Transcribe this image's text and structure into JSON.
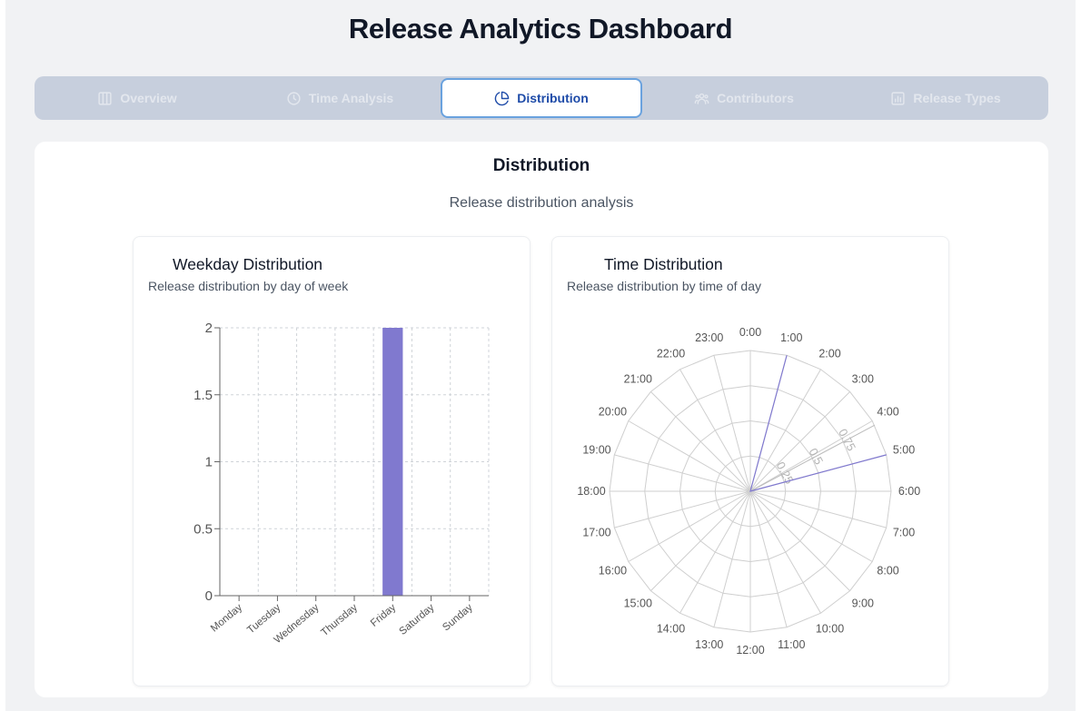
{
  "header": {
    "title": "Release Analytics Dashboard"
  },
  "tabs": [
    {
      "label": "Overview",
      "icon": "columns-icon",
      "active": false
    },
    {
      "label": "Time Analysis",
      "icon": "clock-icon",
      "active": false
    },
    {
      "label": "Distribution",
      "icon": "pie-chart-icon",
      "active": true
    },
    {
      "label": "Contributors",
      "icon": "users-icon",
      "active": false
    },
    {
      "label": "Release Types",
      "icon": "bar-chart-icon",
      "active": false
    }
  ],
  "panel": {
    "title": "Distribution",
    "subtitle": "Release distribution analysis"
  },
  "colors": {
    "bar_fill": "#8079cf",
    "radar_stroke": "#8079cf",
    "active_tab_text": "#1e4ba8",
    "active_tab_border": "#6aa2de"
  },
  "chart_data": [
    {
      "type": "bar",
      "title": "Weekday Distribution",
      "subtitle": "Release distribution by day of week",
      "categories": [
        "Monday",
        "Tuesday",
        "Wednesday",
        "Thursday",
        "Friday",
        "Saturday",
        "Sunday"
      ],
      "values": [
        0,
        0,
        0,
        0,
        2,
        0,
        0
      ],
      "ylim": [
        0,
        2
      ],
      "yticks": [
        "0",
        "0.5",
        "1",
        "1.5",
        "2"
      ],
      "grid": true
    },
    {
      "type": "radar",
      "title": "Time Distribution",
      "subtitle": "Release distribution by time of day",
      "categories": [
        "0:00",
        "1:00",
        "2:00",
        "3:00",
        "4:00",
        "5:00",
        "6:00",
        "7:00",
        "8:00",
        "9:00",
        "10:00",
        "11:00",
        "12:00",
        "13:00",
        "14:00",
        "15:00",
        "16:00",
        "17:00",
        "18:00",
        "19:00",
        "20:00",
        "21:00",
        "22:00",
        "23:00"
      ],
      "values": [
        0,
        1,
        0,
        0,
        0,
        1,
        0,
        0,
        0,
        0,
        0,
        0,
        0,
        0,
        0,
        0,
        0,
        0,
        0,
        0,
        0,
        0,
        0,
        0
      ],
      "rlim": [
        0,
        1
      ],
      "rticks": [
        "0",
        "0.25",
        "0.5",
        "0.75",
        "1"
      ],
      "grid": true
    }
  ]
}
